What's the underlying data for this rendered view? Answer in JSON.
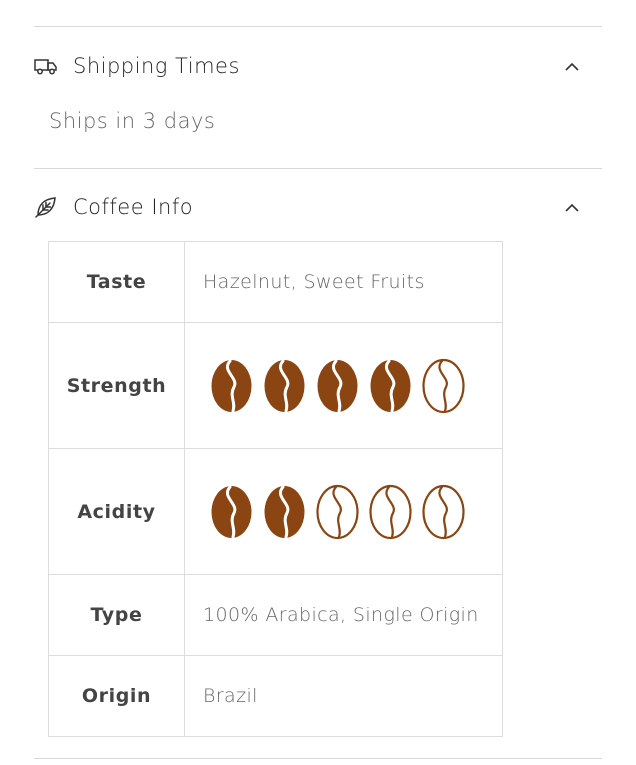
{
  "shipping": {
    "title": "Shipping Times",
    "icon": "truck-icon",
    "body": "Ships in 3 days",
    "expanded": true
  },
  "coffee": {
    "title": "Coffee Info",
    "icon": "leaf-icon",
    "expanded": true,
    "rows": {
      "taste": {
        "label": "Taste",
        "value": "Hazelnut, Sweet Fruits"
      },
      "strength": {
        "label": "Strength",
        "rating": 4,
        "max": 5
      },
      "acidity": {
        "label": "Acidity",
        "rating": 2,
        "max": 5
      },
      "type": {
        "label": "Type",
        "value": "100% Arabica, Single Origin"
      },
      "origin": {
        "label": "Origin",
        "value": "Brazil"
      }
    }
  },
  "colors": {
    "bean": "#8b4513",
    "rule": "#d9d9d9",
    "text": "#333333",
    "muted": "#666666"
  }
}
